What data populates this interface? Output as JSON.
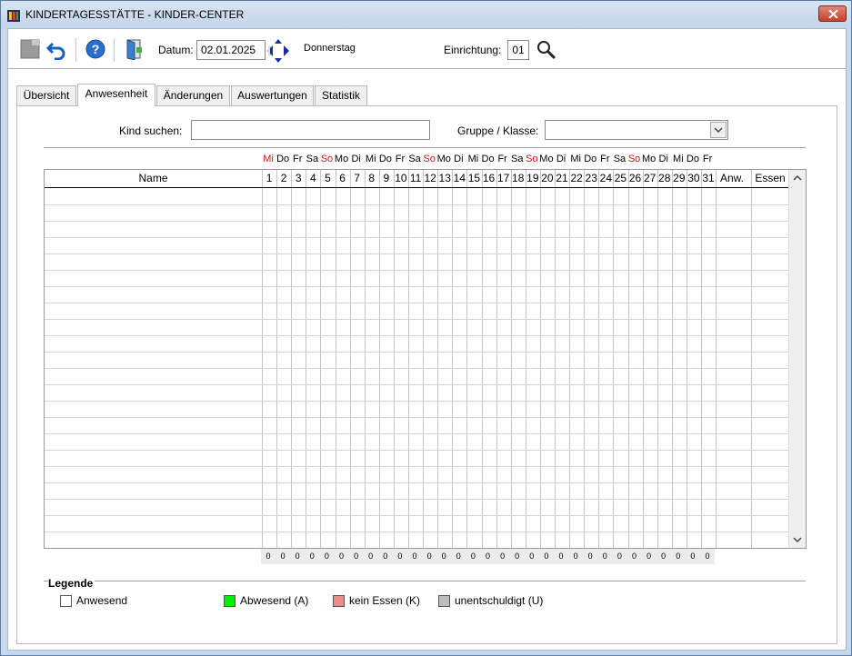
{
  "window": {
    "title": "KINDERTAGESSTÄTTE - KINDER-CENTER"
  },
  "toolbar": {
    "datum_label": "Datum:",
    "datum_value": "02.01.2025",
    "weekday": "Donnerstag",
    "einrichtung_label": "Einrichtung:",
    "einrichtung_value": "01"
  },
  "tabs": [
    {
      "label": "Übersicht",
      "active": false
    },
    {
      "label": "Anwesenheit",
      "active": true
    },
    {
      "label": "Änderungen",
      "active": false
    },
    {
      "label": "Auswertungen",
      "active": false
    },
    {
      "label": "Statistik",
      "active": false
    }
  ],
  "filters": {
    "kind_label": "Kind suchen:",
    "kind_value": "",
    "gruppe_label": "Gruppe / Klasse:",
    "gruppe_value": ""
  },
  "grid": {
    "name_header": "Name",
    "anw_header": "Anw.",
    "essen_header": "Essen",
    "weekdays": [
      "Mi",
      "Do",
      "Fr",
      "Sa",
      "So",
      "Mo",
      "Di",
      "Mi",
      "Do",
      "Fr",
      "Sa",
      "So",
      "Mo",
      "Di",
      "Mi",
      "Do",
      "Fr",
      "Sa",
      "So",
      "Mo",
      "Di",
      "Mi",
      "Do",
      "Fr",
      "Sa",
      "So",
      "Mo",
      "Di",
      "Mi",
      "Do",
      "Fr"
    ],
    "weekday_red": [
      true,
      false,
      false,
      false,
      true,
      false,
      false,
      false,
      false,
      false,
      false,
      true,
      false,
      false,
      false,
      false,
      false,
      false,
      true,
      false,
      false,
      false,
      false,
      false,
      false,
      true,
      false,
      false,
      false,
      false,
      false
    ],
    "days": [
      "1",
      "2",
      "3",
      "4",
      "5",
      "6",
      "7",
      "8",
      "9",
      "10",
      "11",
      "12",
      "13",
      "14",
      "15",
      "16",
      "17",
      "18",
      "19",
      "20",
      "21",
      "22",
      "23",
      "24",
      "25",
      "26",
      "27",
      "28",
      "29",
      "30",
      "31"
    ],
    "totals": [
      "0",
      "0",
      "0",
      "0",
      "0",
      "0",
      "0",
      "0",
      "0",
      "0",
      "0",
      "0",
      "0",
      "0",
      "0",
      "0",
      "0",
      "0",
      "0",
      "0",
      "0",
      "0",
      "0",
      "0",
      "0",
      "0",
      "0",
      "0",
      "0",
      "0",
      "0"
    ],
    "rows": 22
  },
  "legend": {
    "title": "Legende",
    "items": [
      {
        "label": "Anwesend",
        "color": "#ffffff"
      },
      {
        "label": "Abwesend (A)",
        "color": "#00ee00"
      },
      {
        "label": "kein Essen (K)",
        "color": "#f08a8a"
      },
      {
        "label": "unentschuldigt (U)",
        "color": "#bdbdbd"
      }
    ]
  },
  "icons": [
    "app-icon",
    "close-icon",
    "blank-icon",
    "undo-icon",
    "help-icon",
    "exit-door-icon",
    "arrow-left-icon",
    "arrow-up-icon",
    "arrow-down-icon",
    "arrow-right-icon",
    "search-icon",
    "scroll-up-icon",
    "scroll-down-icon"
  ]
}
